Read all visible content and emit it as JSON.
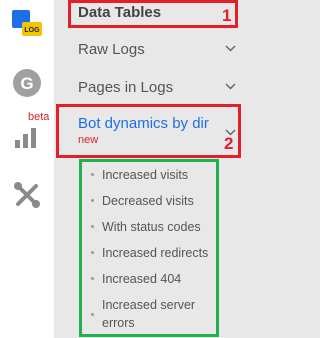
{
  "sidebar": {
    "icons": [
      "log-logo-icon",
      "g-logo-icon",
      "bar-chart-icon",
      "tools-icon"
    ],
    "logo_badge": "LOG",
    "g_letter": "G",
    "beta_label": "beta"
  },
  "menu": {
    "data_tables": "Data Tables",
    "raw_logs": "Raw Logs",
    "pages_in_logs": "Pages in Logs",
    "bot_dynamics": "Bot dynamics by dir",
    "bot_dynamics_badge": "new",
    "subitems": [
      "Increased visits",
      "Decreased visits",
      "With status codes",
      "Increased redirects",
      "Increased 404",
      "Increased server",
      "errors"
    ]
  },
  "annotations": {
    "label_1": "1",
    "label_2": "2"
  },
  "colors": {
    "accent_blue": "#1e6fe6",
    "red_box": "#e0202a",
    "green_box": "#21b04b",
    "beta_red": "#e0202a"
  }
}
